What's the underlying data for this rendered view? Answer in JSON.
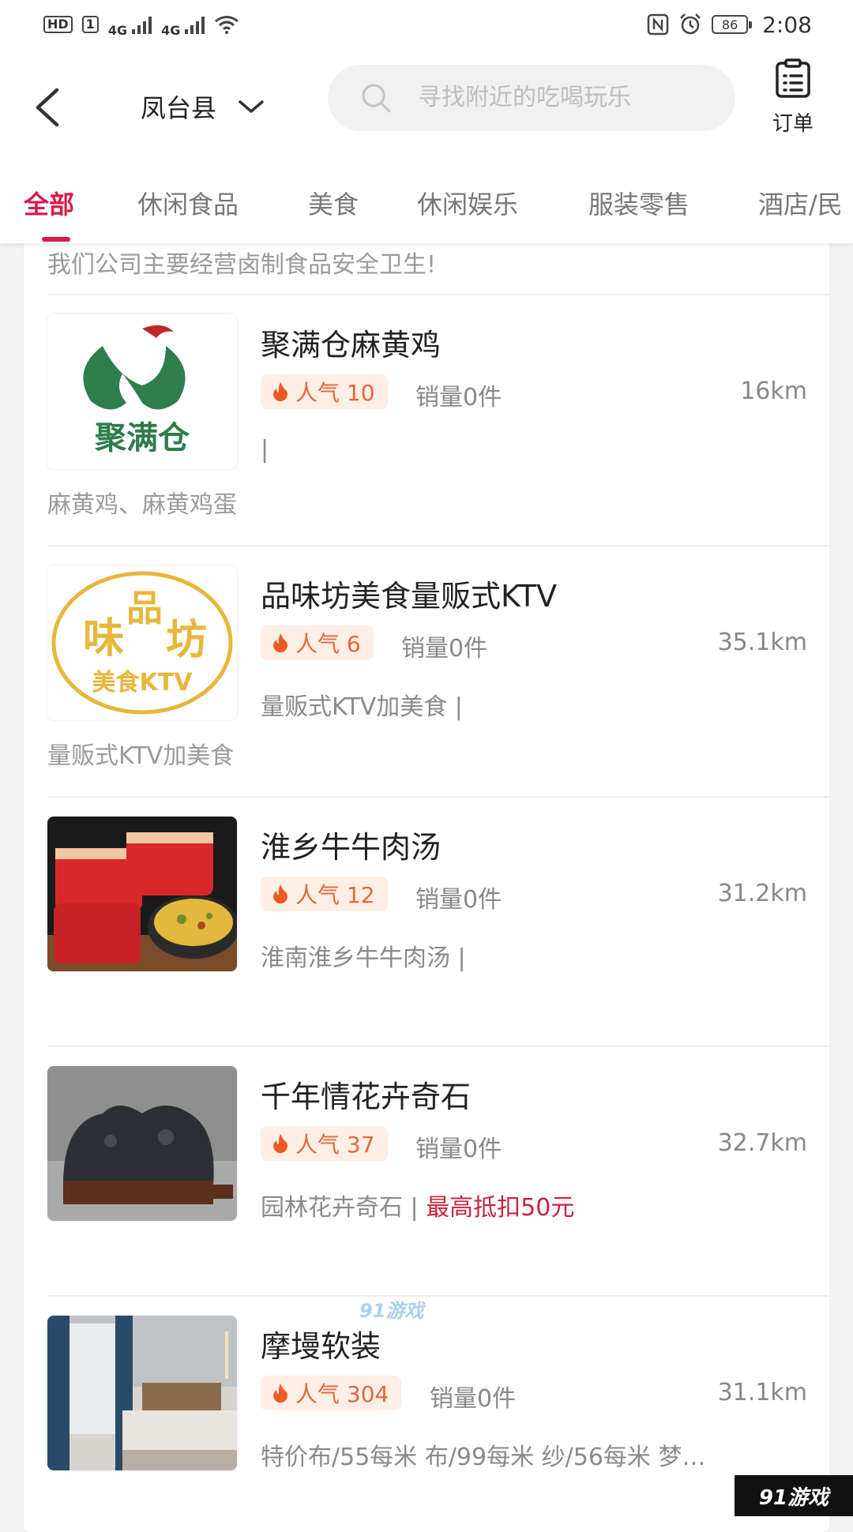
{
  "status_bar": {
    "hd_tag": "HD",
    "sim_tag": "1",
    "network_1": "4G",
    "network_2": "4G",
    "battery": "86",
    "time": "2:08",
    "icons": [
      "signal-icon",
      "wifi-icon",
      "nfc-icon",
      "alarm-icon",
      "battery-icon"
    ]
  },
  "header": {
    "city": "凤台县",
    "search_placeholder": "寻找附近的吃喝玩乐",
    "orders_label": "订单"
  },
  "tabs": [
    {
      "label": "全部",
      "active": true
    },
    {
      "label": "休闲食品",
      "active": false
    },
    {
      "label": "美食",
      "active": false
    },
    {
      "label": "休闲娱乐",
      "active": false
    },
    {
      "label": "服装零售",
      "active": false
    },
    {
      "label": "酒店/民",
      "active": false
    }
  ],
  "list": {
    "top_desc": "我们公司主要经营卤制食品安全卫生!",
    "items": [
      {
        "name": "聚满仓麻黄鸡",
        "popularity": "人气 10",
        "sales": "销量0件",
        "distance": "16km",
        "tags": "|",
        "discount": "",
        "desc": "麻黄鸡、麻黄鸡蛋",
        "logo_text": "聚满仓"
      },
      {
        "name": "品味坊美食量贩式KTV",
        "popularity": "人气 6",
        "sales": "销量0件",
        "distance": "35.1km",
        "tags": "量贩式KTV加美食 |",
        "discount": "",
        "desc": "量贩式KTV加美食",
        "logo_text_1": "味",
        "logo_text_2": "品",
        "logo_text_3": "坊",
        "logo_text_4": "美食KTV"
      },
      {
        "name": "淮乡牛牛肉汤",
        "popularity": "人气 12",
        "sales": "销量0件",
        "distance": "31.2km",
        "tags": "淮南淮乡牛牛肉汤 |",
        "discount": "",
        "desc": ""
      },
      {
        "name": "千年情花卉奇石",
        "popularity": "人气 37",
        "sales": "销量0件",
        "distance": "32.7km",
        "tags": "园林花卉奇石 | ",
        "discount": "最高抵扣50元",
        "desc": ""
      },
      {
        "name": "摩墁软装",
        "popularity": "人气 304",
        "sales": "销量0件",
        "distance": "31.1km",
        "tags": "特价布/55每米 布/99每米 纱/56每米 梦…",
        "discount": "",
        "desc": ""
      }
    ]
  },
  "watermark": {
    "mid": "91游戏",
    "corner": "91游戏"
  },
  "colors": {
    "accent": "#d81b4a",
    "popularity_bg": "#fdeee6",
    "popularity_text": "#e2693a",
    "discount": "#c5253f"
  }
}
